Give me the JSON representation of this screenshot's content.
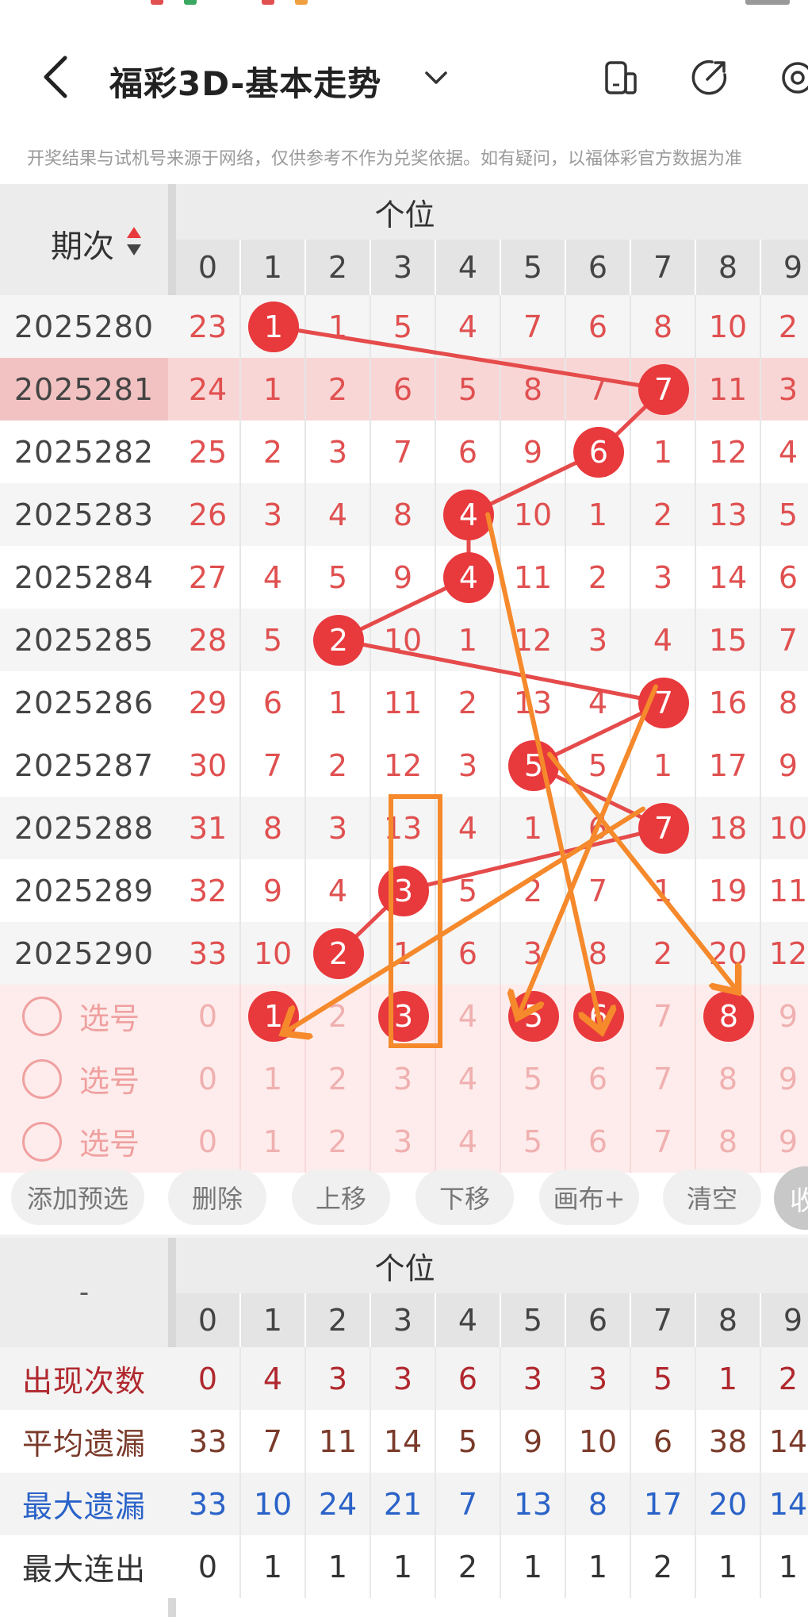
{
  "header": {
    "title": "福彩3D-基本走势",
    "notice": "开奖结果与试机号来源于网络，仅供参考不作为兑奖依据。如有疑问，以福体彩官方数据为准"
  },
  "table": {
    "period_label": "期次",
    "group_label": "个位",
    "digits": [
      "0",
      "1",
      "2",
      "3",
      "4",
      "5",
      "6",
      "7",
      "8",
      "9"
    ],
    "rows": [
      {
        "period": "2025280",
        "values": [
          "23",
          "1",
          "1",
          "5",
          "4",
          "7",
          "6",
          "8",
          "10",
          "2"
        ],
        "hit": 1
      },
      {
        "period": "2025281",
        "values": [
          "24",
          "1",
          "2",
          "6",
          "5",
          "8",
          "7",
          "7",
          "11",
          "3"
        ],
        "hit": 7
      },
      {
        "period": "2025282",
        "values": [
          "25",
          "2",
          "3",
          "7",
          "6",
          "9",
          "6",
          "1",
          "12",
          "4"
        ],
        "hit": 6
      },
      {
        "period": "2025283",
        "values": [
          "26",
          "3",
          "4",
          "8",
          "4",
          "10",
          "1",
          "2",
          "13",
          "5"
        ],
        "hit": 4
      },
      {
        "period": "2025284",
        "values": [
          "27",
          "4",
          "5",
          "9",
          "4",
          "11",
          "2",
          "3",
          "14",
          "6"
        ],
        "hit": 4
      },
      {
        "period": "2025285",
        "values": [
          "28",
          "5",
          "2",
          "10",
          "1",
          "12",
          "3",
          "4",
          "15",
          "7"
        ],
        "hit": 2
      },
      {
        "period": "2025286",
        "values": [
          "29",
          "6",
          "1",
          "11",
          "2",
          "13",
          "4",
          "7",
          "16",
          "8"
        ],
        "hit": 7
      },
      {
        "period": "2025287",
        "values": [
          "30",
          "7",
          "2",
          "12",
          "3",
          "5",
          "5",
          "1",
          "17",
          "9"
        ],
        "hit": 5
      },
      {
        "period": "2025288",
        "values": [
          "31",
          "8",
          "3",
          "13",
          "4",
          "1",
          "6",
          "7",
          "18",
          "10"
        ],
        "hit": 7
      },
      {
        "period": "2025289",
        "values": [
          "32",
          "9",
          "4",
          "3",
          "5",
          "2",
          "7",
          "1",
          "19",
          "11"
        ],
        "hit": 3
      },
      {
        "period": "2025290",
        "values": [
          "33",
          "10",
          "2",
          "1",
          "6",
          "3",
          "8",
          "2",
          "20",
          "12"
        ],
        "hit": 2
      }
    ],
    "pick_label": "选号",
    "pick_rows": [
      {
        "values": [
          "0",
          "1",
          "2",
          "3",
          "4",
          "5",
          "6",
          "7",
          "8",
          "9"
        ],
        "selected": [
          1,
          3,
          5,
          6,
          8
        ]
      },
      {
        "values": [
          "0",
          "1",
          "2",
          "3",
          "4",
          "5",
          "6",
          "7",
          "8",
          "9"
        ],
        "selected": []
      },
      {
        "values": [
          "0",
          "1",
          "2",
          "3",
          "4",
          "5",
          "6",
          "7",
          "8",
          "9"
        ],
        "selected": []
      }
    ]
  },
  "toolbar": {
    "add": "添加预选",
    "delete": "删除",
    "up": "上移",
    "down": "下移",
    "canvas": "画布+",
    "clear": "清空",
    "collapse": "收"
  },
  "stats": {
    "left_label": "-",
    "group_label": "个位",
    "digits": [
      "0",
      "1",
      "2",
      "3",
      "4",
      "5",
      "6",
      "7",
      "8",
      "9"
    ],
    "rows": [
      {
        "label": "出现次数",
        "values": [
          "0",
          "4",
          "3",
          "3",
          "6",
          "3",
          "3",
          "5",
          "1",
          "2"
        ],
        "color": "#b0282e"
      },
      {
        "label": "平均遗漏",
        "values": [
          "33",
          "7",
          "11",
          "14",
          "5",
          "9",
          "10",
          "6",
          "38",
          "14"
        ],
        "color": "#7a3a2a"
      },
      {
        "label": "最大遗漏",
        "values": [
          "33",
          "10",
          "24",
          "21",
          "7",
          "13",
          "8",
          "17",
          "20",
          "14"
        ],
        "color": "#2a62c8"
      },
      {
        "label": "最大连出",
        "values": [
          "0",
          "1",
          "1",
          "1",
          "2",
          "1",
          "1",
          "2",
          "1",
          "1"
        ],
        "color": "#333333"
      }
    ]
  },
  "colors": {
    "ball": "#e8393c",
    "miss_text": "#e05050",
    "highlight_row": "#f9d6d6",
    "pick_bg": "#fdeceb",
    "orange_mark": "#f5892b"
  }
}
